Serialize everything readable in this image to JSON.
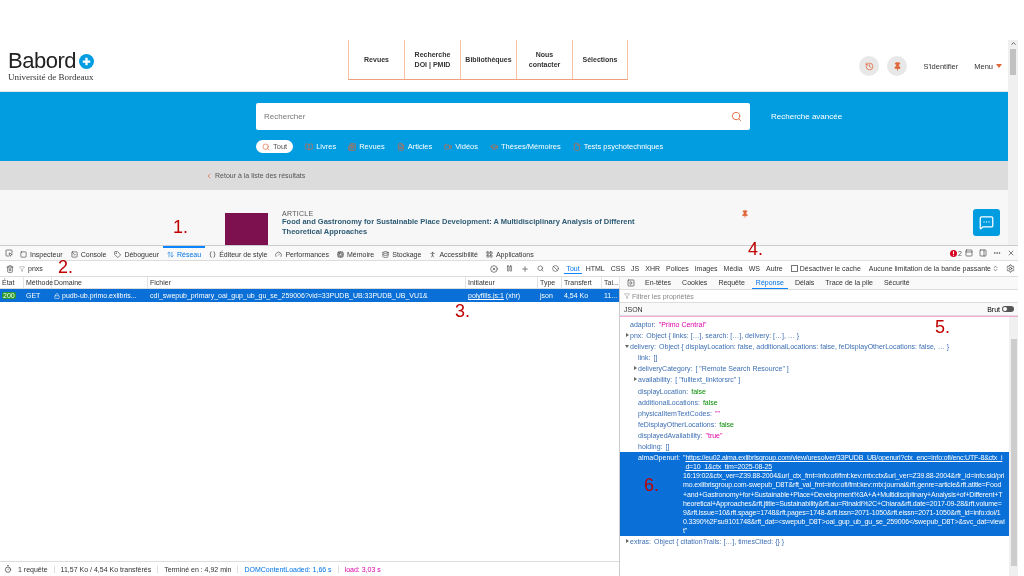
{
  "site": {
    "logo": "Babord",
    "logo_subtitle": "Université de Bordeaux",
    "nav": [
      {
        "label": "Revues"
      },
      {
        "label": "Recherche DOI | PMID"
      },
      {
        "label": "Bibliothèques"
      },
      {
        "label": "Nous contacter"
      },
      {
        "label": "Sélections"
      }
    ],
    "sign_in": "S'identifier",
    "menu": "Menu"
  },
  "search": {
    "placeholder": "Rechercher",
    "advanced": "Recherche avancée",
    "scopes": [
      {
        "label": "Tout",
        "selected": true
      },
      {
        "label": "Livres",
        "selected": false
      },
      {
        "label": "Revues",
        "selected": false
      },
      {
        "label": "Articles",
        "selected": false
      },
      {
        "label": "Vidéos",
        "selected": false
      },
      {
        "label": "Thèses/Mémoires",
        "selected": false
      },
      {
        "label": "Tests psychotechniques",
        "selected": false
      }
    ]
  },
  "back_link": "Retour à la liste des résultats",
  "result": {
    "type": "ARTICLE",
    "title": "Food and Gastronomy for Sustainable Place Development: A Multidisciplinary Analysis of Different Theoretical Approaches"
  },
  "devtools": {
    "tools": [
      {
        "label": "Inspecteur",
        "selected": false
      },
      {
        "label": "Console",
        "selected": false
      },
      {
        "label": "Débogueur",
        "selected": false
      },
      {
        "label": "Réseau",
        "selected": true
      },
      {
        "label": "Éditeur de style",
        "selected": false
      },
      {
        "label": "Performances",
        "selected": false
      },
      {
        "label": "Mémoire",
        "selected": false
      },
      {
        "label": "Stockage",
        "selected": false
      },
      {
        "label": "Accessibilité",
        "selected": false
      },
      {
        "label": "Applications",
        "selected": false
      }
    ],
    "error_count": "2",
    "filter": {
      "value": "pnxs"
    },
    "type_filters": [
      {
        "label": "Tout",
        "selected": true
      },
      {
        "label": "HTML",
        "selected": false
      },
      {
        "label": "CSS",
        "selected": false
      },
      {
        "label": "JS",
        "selected": false
      },
      {
        "label": "XHR",
        "selected": false
      },
      {
        "label": "Polices",
        "selected": false
      },
      {
        "label": "Images",
        "selected": false
      },
      {
        "label": "Média",
        "selected": false
      },
      {
        "label": "WS",
        "selected": false
      },
      {
        "label": "Autre",
        "selected": false
      }
    ],
    "disable_cache": {
      "label": "Désactiver le cache",
      "checked": false
    },
    "throttling": "Aucune limitation de la bande passante",
    "columns": [
      "État",
      "Méthode",
      "Domaine",
      "Fichier",
      "Initiateur",
      "Type",
      "Transfert",
      "Tai..."
    ],
    "requests": [
      {
        "status": "200",
        "method": "GET",
        "domain": "pudb-ub.primo.exlibris...",
        "file": "cdi_swepub_primary_oai_gup_ub_gu_se_259006?vid=33PUDB_UB:33PUDB_UB_VU1&",
        "initiator": "polyfills.js:1",
        "initiator_type": "(xhr)",
        "type": "json",
        "transfer": "4,54 Ko",
        "size": "11...",
        "selected": true
      }
    ],
    "detail_tabs": [
      {
        "label": "En-têtes",
        "selected": false
      },
      {
        "label": "Cookies",
        "selected": false
      },
      {
        "label": "Requête",
        "selected": false
      },
      {
        "label": "Réponse",
        "selected": true
      },
      {
        "label": "Délais",
        "selected": false
      },
      {
        "label": "Trace de la pile",
        "selected": false
      },
      {
        "label": "Sécurité",
        "selected": false
      }
    ],
    "property_filter": {
      "placeholder": "Filtrer les propriétés"
    },
    "format": "JSON",
    "raw": {
      "label": "Brut",
      "on": false
    },
    "tree": [
      {
        "key": "adaptor:",
        "kind": "string",
        "value": "\"Primo Central\"",
        "selected": false
      },
      {
        "key": "pnx:",
        "kind": "object",
        "value": "Object { links: […], search: […], delivery: […], … }",
        "expanded": false,
        "selected": false
      },
      {
        "key": "delivery:",
        "kind": "object",
        "value": "Object { displayLocation: false, additionalLocations: false, feDisplayOtherLocations: false, … }",
        "expanded": true,
        "selected": false,
        "children": [
          {
            "key": "link:",
            "kind": "empty",
            "value": "[]",
            "selected": false
          },
          {
            "key": "deliveryCategory:",
            "kind": "array",
            "value": "[ \"Remote Search Resource\" ]",
            "expanded": false,
            "selected": false
          },
          {
            "key": "availability:",
            "kind": "array",
            "value": "[ \"fulltext_linktorsrc\" ]",
            "expanded": false,
            "selected": false
          },
          {
            "key": "displayLocation:",
            "kind": "bool",
            "value": "false",
            "selected": false
          },
          {
            "key": "additionalLocations:",
            "kind": "bool",
            "value": "false",
            "selected": false
          },
          {
            "key": "physicalItemTextCodes:",
            "kind": "string",
            "value": "\"\"",
            "selected": false
          },
          {
            "key": "feDisplayOtherLocations:",
            "kind": "bool",
            "value": "false",
            "selected": false
          },
          {
            "key": "displayedAvailability:",
            "kind": "string",
            "value": "\"true\"",
            "selected": false
          },
          {
            "key": "holding:",
            "kind": "empty",
            "value": "[]",
            "selected": false
          },
          {
            "key": "almaOpenurl:",
            "kind": "url",
            "value": "\"",
            "link": "https://eu02.alma.exlibrisgroup.com/view/uresolver/33PUDB_UB/openurl?ctx_enc=info:ofi/enc:UTF-8&ctx_id=10_1&ctx_tim=2025-08-25",
            "rest": " 16:19:02&ctx_ver=Z39.88-2004&url_ctx_fmt=info:ofi/fmt:kev:mtx:ctx&url_ver=Z39.88-2004&rfr_id=info:sid/primo.exlibrisgroup.com-swepub_D8T&rft_val_fmt=info:ofi/fmt:kev:mtx:journal&rft.genre=article&rft.atitle=Food+and+Gastronomy+for+Sustainable+Place+Development%3A+A+Multidisciplinary+Analysis+of+Different+Theoretical+Approaches&rft.jtitle=Sustainability&rft.au=Rinaldi%2C+Chiara&rft.date=2017-09-28&rft.volume=9&rft.issue=10&rft.spage=1748&rft.pages=1748-&rft.issn=2071-1050&rft.eissn=2071-1050&rft_id=info:doi/10.3390%2Fsu9101748&rft_dat=<swepub_D8T>oai_gup_ub_gu_se_259006</swepub_D8T>&svc_dat=viewit\"",
            "selected": true
          }
        ]
      },
      {
        "key": "extras:",
        "kind": "object",
        "value": "Object { citationTrails: […], timesCited: {} }",
        "expanded": false,
        "selected": false
      }
    ],
    "status_bar": [
      {
        "text": "1 requête",
        "kind": "plain"
      },
      {
        "text": "11,57 Ko / 4,54 Ko transférés",
        "kind": "plain"
      },
      {
        "text": "Terminé en : 4,92 min",
        "kind": "plain"
      },
      {
        "text": "DOMContentLoaded: 1,66 s",
        "kind": "dom"
      },
      {
        "text": "load: 3,03 s",
        "kind": "load"
      }
    ]
  },
  "annotations": [
    "1.",
    "2.",
    "3.",
    "4.",
    "5.",
    "6."
  ]
}
